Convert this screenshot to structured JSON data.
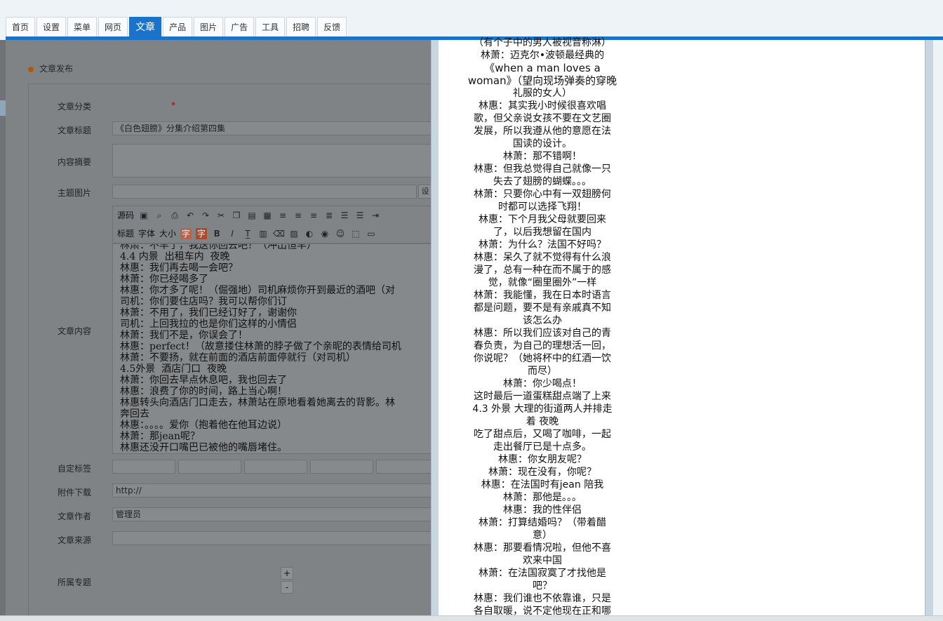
{
  "nav": {
    "tabs": [
      "首页",
      "设置",
      "菜单",
      "网页",
      "文章",
      "产品",
      "图片",
      "广告",
      "工具",
      "招聘",
      "反馈"
    ],
    "active_index": 4
  },
  "form": {
    "section_title": "文章发布",
    "labels": {
      "category": "文章分类",
      "title": "文章标题",
      "summary": "内容摘要",
      "image": "主题图片",
      "content": "文章内容",
      "tags": "自定标签",
      "attachment": "附件下载",
      "author": "文章作者",
      "source": "文章来源",
      "topic": "所属专题"
    },
    "required_mark": "*",
    "title_value": "《白色翅膀》分集介绍第四集",
    "attachment_value": "http://",
    "author_value": "管理员",
    "image_button_label": "设",
    "toolbar_row1": [
      "源码"
    ],
    "toolbar_row2": [
      "标题",
      "字体",
      "大小"
    ],
    "editor_lines": [
      "林肃：不早了，我送你回去吧？（冲出恒早）",
      "4.4 内景  出租车内  夜晚",
      "林惠：我们再去喝一会吧？",
      "林萧：你已经喝多了",
      "林惠：你才多了呢！（倔强地）司机麻烦你开到最近的酒吧（对",
      "司机：你们要住店吗？我可以帮你们订",
      "林萧：不用了，我们已经订好了，谢谢你",
      "司机：上回我拉的也是你们这样的小情侣",
      "林萧：我们不是，你误会了！",
      "林惠：perfect！（故意搂住林萧的脖子做了个亲昵的表情给司机",
      "林萧：不要扬，就在前面的酒店前面停就行（对司机）",
      "4.5外景  酒店门口  夜晚",
      "林萧：你回去早点休息吧，我也回去了",
      "林惠：浪费了你的时间，路上当心啊！",
      "林惠转头向酒店门口走去，林萧站在原地看着她离去的背影。林",
      "奔回去",
      "林惠：。。。。爱你（抱着他在他耳边说）",
      "林萧：那jean呢？",
      "林惠还没开口嘴巴已被他的嘴唇堵住。"
    ],
    "spin_plus": "+",
    "spin_minus": "-"
  },
  "preview": {
    "lines": [
      "（有个子中的男人被视音称淋）",
      "林萧：迈克尔•波顿最经典的",
      "《when a man loves a",
      "woman》（望向现场弹奏的穿晚",
      "礼服的女人）",
      "林惠：其实我小时候很喜欢唱",
      "歌，但父亲说女孩不要在文艺圈",
      "发展，所以我遵从他的意愿在法",
      "国读的设计。",
      "林萧：那不错啊！",
      "林惠：但我总觉得自己就像一只",
      "失去了翅膀的蝴蝶。。。",
      "林萧：只要你心中有一双翅膀何",
      "时都可以选择飞翔！",
      "林惠：下个月我父母就要回来",
      "了，以后我想留在国内",
      "林萧：为什么？法国不好吗？",
      "林惠：呆久了就不觉得有什么浪",
      "漫了，总有一种在而不属于的感",
      "觉，就像“圈里圈外”一样",
      "林萧：我能懂，我在日本时语言",
      "都是问题，要不是有亲戚真不知",
      "该怎么办",
      "林惠：所以我们应该对自己的青",
      "春负责，为自己的理想活一回，",
      "你说呢？（她将杯中的红酒一饮",
      "而尽）",
      "林萧：你少喝点！",
      "这时最后一道蛋糕甜点端了上来",
      "4.3 外景  大理的街道两人并排走",
      "着  夜晚",
      "吃了甜点后，又喝了咖啡，一起",
      "走出餐厅已是十点多。",
      "林惠：你女朋友呢？",
      "林萧：现在没有，你呢？",
      "林惠：在法国时有jean 陪我",
      "林萧：那他是。。。",
      "林惠：我的性伴侣",
      "林萧：打算结婚吗？（带着醋",
      "意）",
      "林惠：那要看情况啦，但他不喜",
      "欢来中国",
      "林萧：在法国寂寞了才找他是",
      "吧？",
      "林惠：我们谁也不依靠谁，只是",
      "各自取暖，说不定他现在正和哪"
    ]
  }
}
